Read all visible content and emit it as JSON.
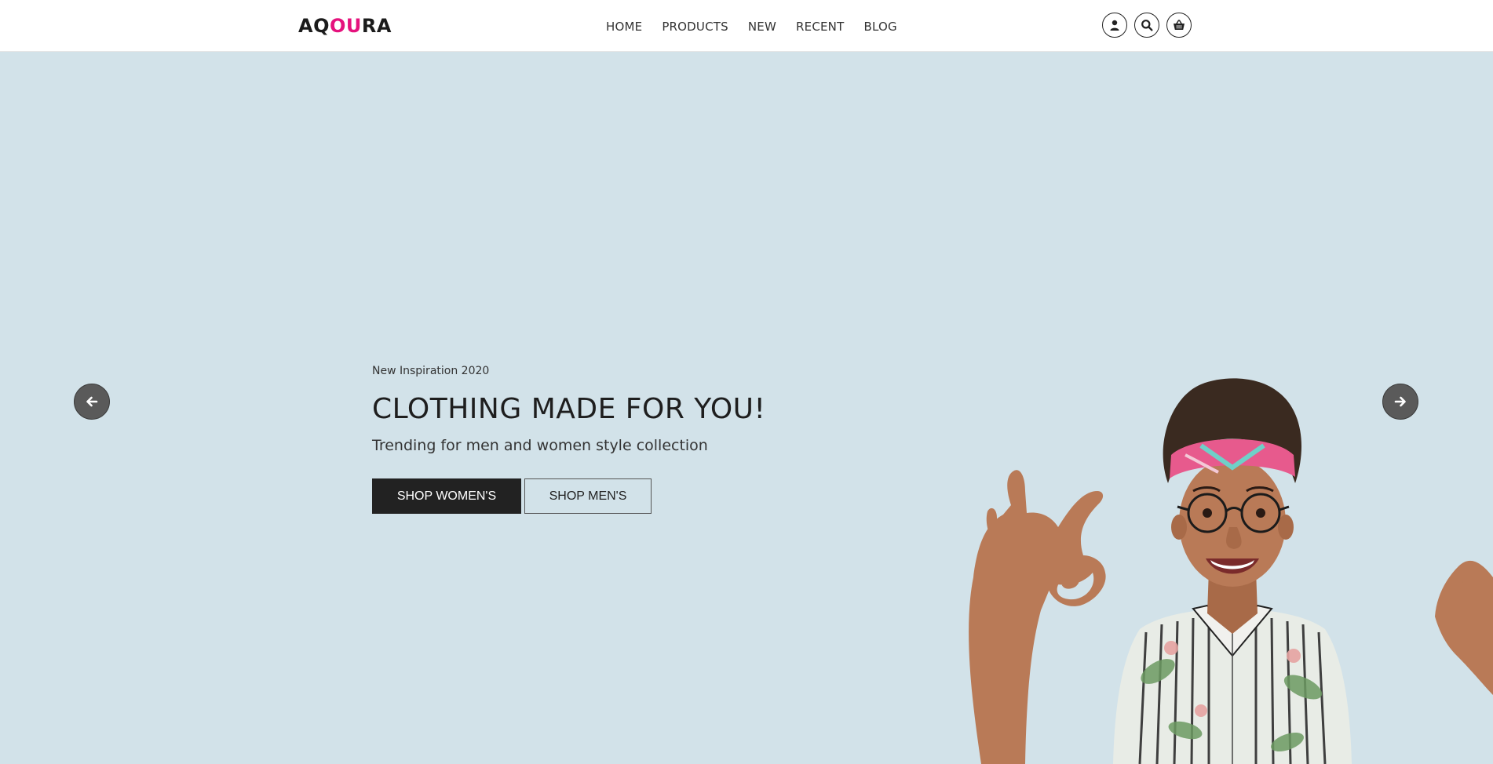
{
  "header": {
    "logo": {
      "part1": "AQ",
      "accent": "OU",
      "part2": "RA",
      "accent_color": "#e5127d"
    },
    "nav": [
      "HOME",
      "PRODUCTS",
      "NEW",
      "RECENT",
      "BLOG"
    ],
    "icons": [
      "user-icon",
      "search-icon",
      "basket-icon"
    ]
  },
  "hero": {
    "eyebrow": "New Inspiration 2020",
    "headline": "CLOTHING MADE FOR YOU!",
    "subline": "Trending for men and women style collection",
    "primary_button": "SHOP WOMEN'S",
    "secondary_button": "SHOP MEN'S",
    "background_color": "#d2e2e9",
    "prev_icon": "arrow-left-icon",
    "next_icon": "arrow-right-icon",
    "image": "woman-ok-gesture-illustration"
  }
}
